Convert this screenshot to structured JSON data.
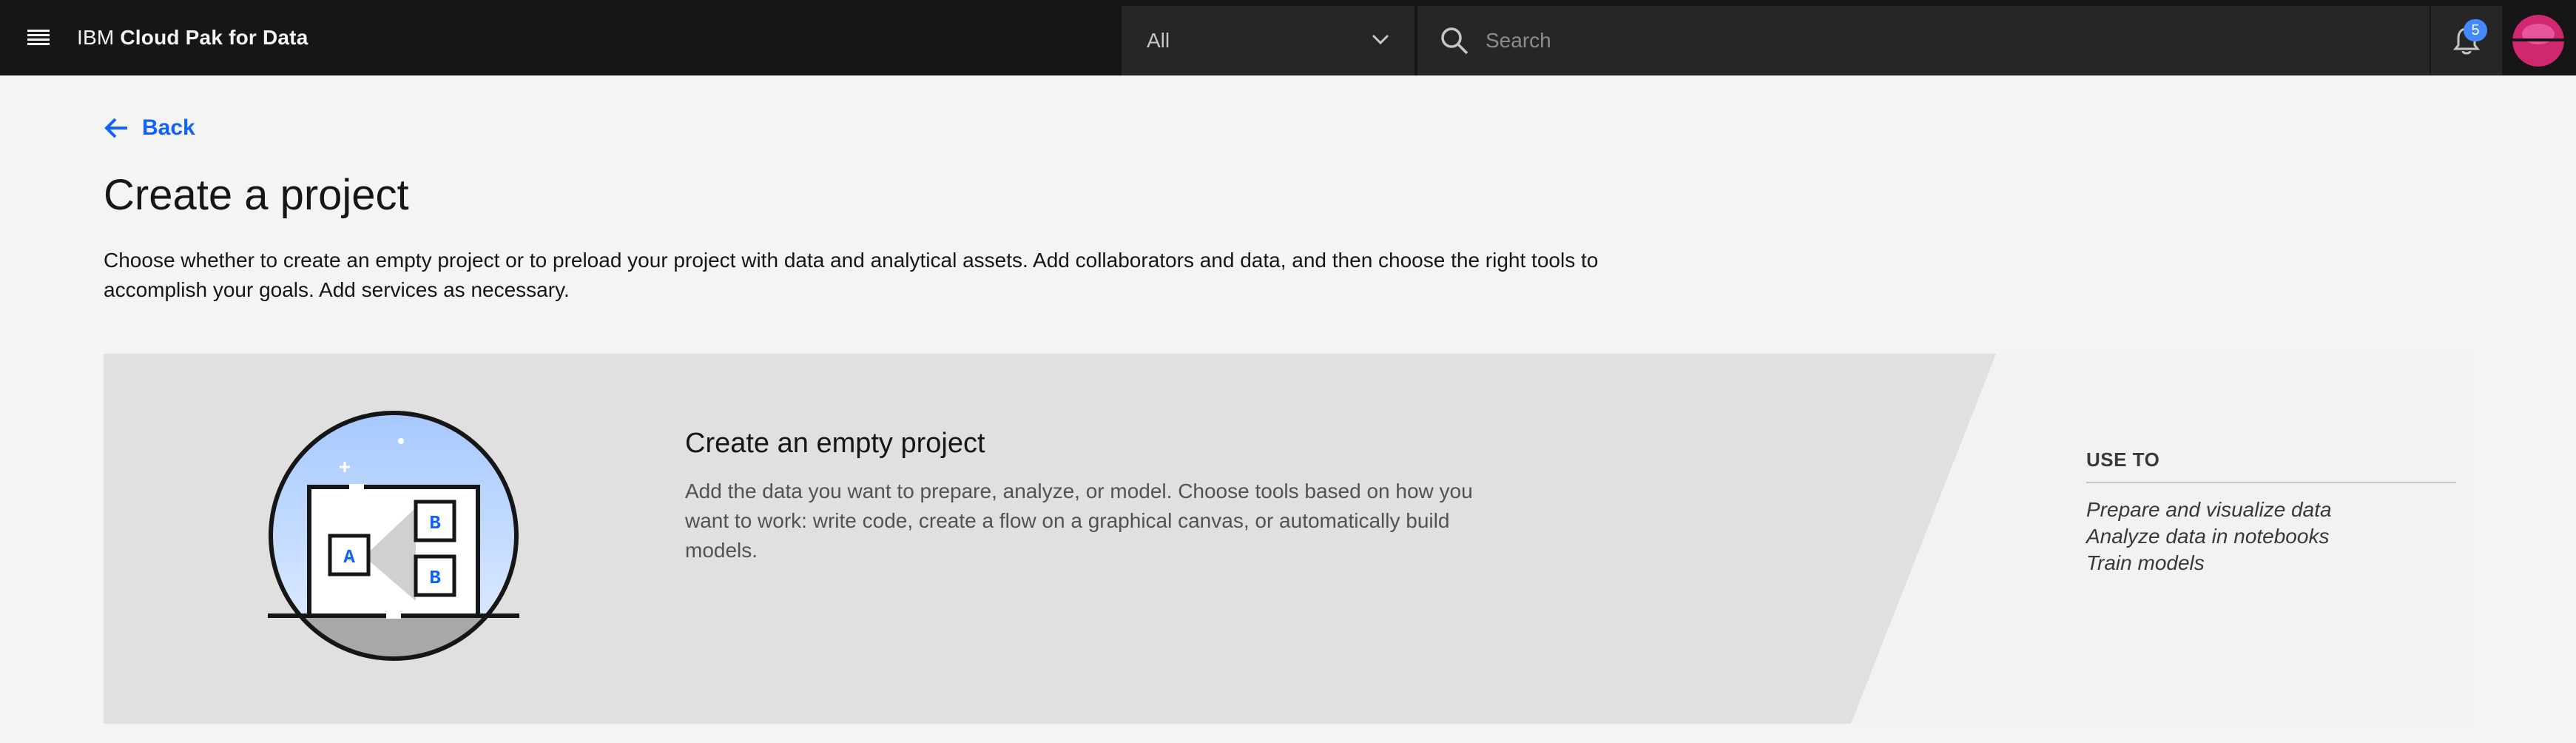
{
  "header": {
    "brand_prefix": "IBM",
    "brand_name": "Cloud Pak for Data",
    "scope_selected": "All",
    "search_placeholder": "Search",
    "notification_count": "5"
  },
  "page": {
    "back_label": "Back",
    "title": "Create a project",
    "description": "Choose whether to create an empty project or to preload your project with data and analytical assets. Add collaborators and data, and then choose the right tools to accomplish your goals. Add services as necessary."
  },
  "card": {
    "title": "Create an empty project",
    "description": "Add the data you want to prepare, analyze, or model. Choose tools based on how you want to work: write code, create a flow on a graphical canvas, or automatically build models.",
    "use_to_heading": "USE TO",
    "use_to_items": [
      "Prepare and visualize data",
      "Analyze data in notebooks",
      "Train models"
    ],
    "illustration_labels": [
      "A",
      "B",
      "B"
    ]
  },
  "colors": {
    "header_bg": "#161616",
    "accent": "#0f62fe",
    "card_bg": "#e0e0e0",
    "badge": "#4589ff",
    "avatar": "#d12771"
  }
}
